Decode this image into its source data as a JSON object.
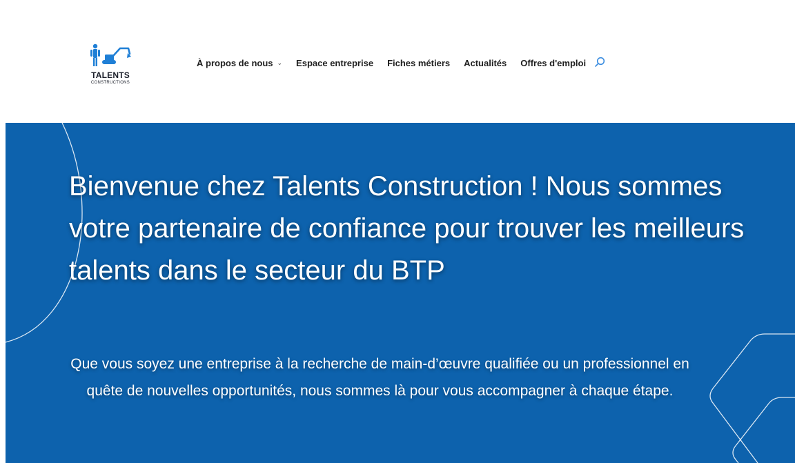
{
  "logo": {
    "title": "TALENTS",
    "subtitle": "CONSTRUCTIONS",
    "icon": "worker-excavator-logo"
  },
  "nav": {
    "items": [
      {
        "label": "À propos de nous",
        "has_dropdown": true
      },
      {
        "label": "Espace entreprise"
      },
      {
        "label": "Fiches métiers"
      },
      {
        "label": "Actualités"
      },
      {
        "label": "Offres d'emploi"
      }
    ],
    "search_icon": "search-icon"
  },
  "hero": {
    "title": "Bienvenue chez Talents Construction ! Nous sommes votre partenaire de confiance pour trouver les meilleurs talents dans le secteur du BTP",
    "subtitle": "Que vous soyez une entreprise à la recherche de main-d’œuvre qualifiée ou un professionnel en quête de nouvelles opportunités, nous sommes là pour vous accompagner à chaque étape."
  },
  "colors": {
    "hero_background": "#0d62ad",
    "logo_accent": "#1f7fd6",
    "search_icon": "#3b8de0",
    "nav_text": "#1e1e1e"
  }
}
